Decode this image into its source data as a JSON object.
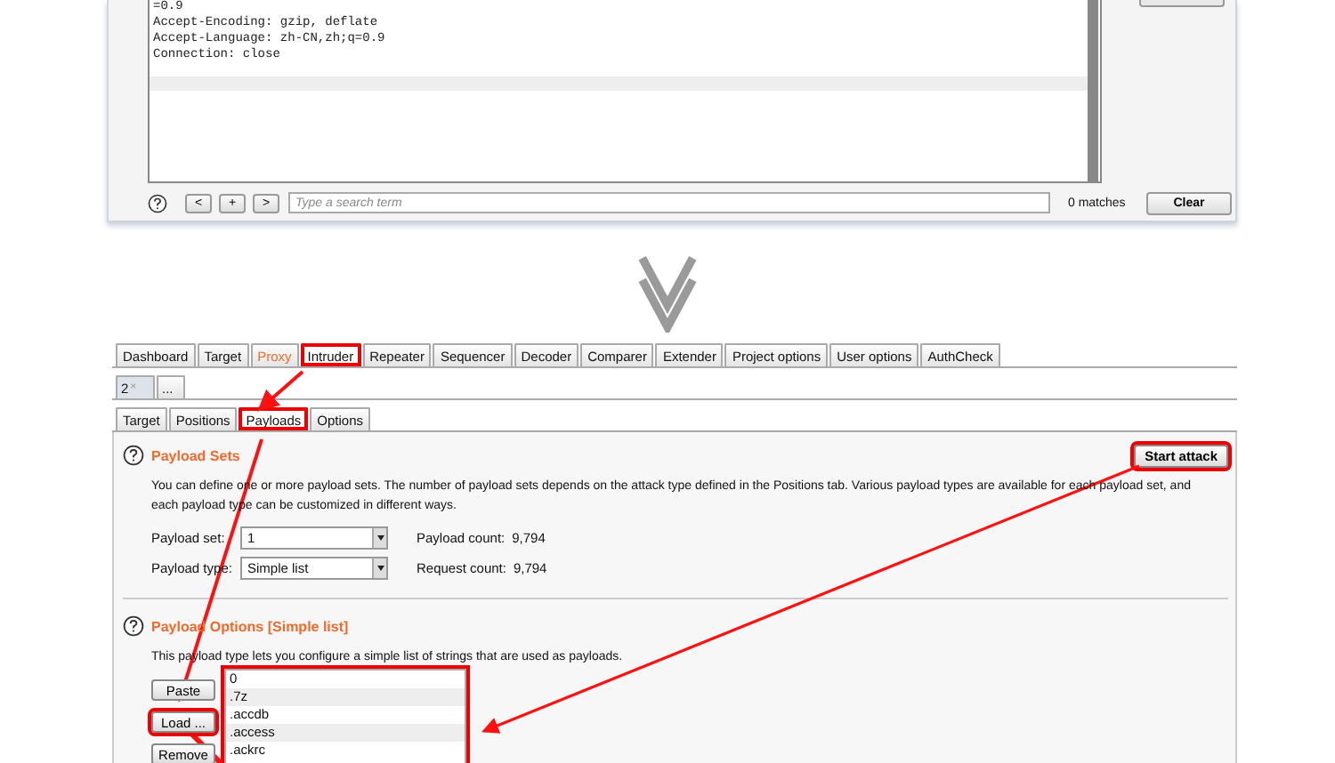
{
  "request_editor": {
    "lines": [
      "=0.9",
      "Accept-Encoding: gzip, deflate",
      "Accept-Language: zh-CN,zh;q=0.9",
      "Connection: close"
    ],
    "search": {
      "buttons": [
        "<",
        "+",
        ">"
      ],
      "placeholder": "Type a search term",
      "matches": "0 matches",
      "clear_button": "Clear"
    }
  },
  "main_tabs": [
    {
      "label": "Dashboard",
      "selected": false,
      "alert": false,
      "highlighted": false
    },
    {
      "label": "Target",
      "selected": false,
      "alert": false,
      "highlighted": false
    },
    {
      "label": "Proxy",
      "selected": false,
      "alert": true,
      "highlighted": false
    },
    {
      "label": "Intruder",
      "selected": true,
      "alert": false,
      "highlighted": true
    },
    {
      "label": "Repeater",
      "selected": false,
      "alert": false,
      "highlighted": false
    },
    {
      "label": "Sequencer",
      "selected": false,
      "alert": false,
      "highlighted": false
    },
    {
      "label": "Decoder",
      "selected": false,
      "alert": false,
      "highlighted": false
    },
    {
      "label": "Comparer",
      "selected": false,
      "alert": false,
      "highlighted": false
    },
    {
      "label": "Extender",
      "selected": false,
      "alert": false,
      "highlighted": false
    },
    {
      "label": "Project options",
      "selected": false,
      "alert": false,
      "highlighted": false
    },
    {
      "label": "User options",
      "selected": false,
      "alert": false,
      "highlighted": false
    },
    {
      "label": "AuthCheck",
      "selected": false,
      "alert": false,
      "highlighted": false
    }
  ],
  "attack_tabs": [
    {
      "label": "2",
      "close": "×",
      "selected": true
    },
    {
      "label": "...",
      "selected": false
    }
  ],
  "sub_tabs": [
    {
      "label": "Target",
      "selected": false,
      "highlighted": false
    },
    {
      "label": "Positions",
      "selected": false,
      "highlighted": false
    },
    {
      "label": "Payloads",
      "selected": true,
      "highlighted": true
    },
    {
      "label": "Options",
      "selected": false,
      "highlighted": false
    }
  ],
  "payload_sets": {
    "title": "Payload Sets",
    "start_attack": {
      "label": "Start attack",
      "highlighted": true
    },
    "description": "You can define one or more payload sets. The number of payload sets depends on the attack type defined in the Positions tab. Various payload types are available for each payload set, and each payload type can be customized in different ways.",
    "fields": [
      {
        "label": "Payload set:",
        "value": "1",
        "info_label": "Payload count:",
        "info_value": "9,794"
      },
      {
        "label": "Payload type:",
        "value": "Simple list",
        "info_label": "Request count:",
        "info_value": "9,794"
      }
    ]
  },
  "payload_options": {
    "title": "Payload Options [Simple list]",
    "description": "This payload type lets you configure a simple list of strings that are used as payloads.",
    "buttons": [
      {
        "label": "Paste",
        "highlighted": false
      },
      {
        "label": "Load ...",
        "highlighted": true
      },
      {
        "label": "Remove",
        "highlighted": false
      }
    ],
    "list_highlighted": true,
    "items": [
      "0",
      ".7z",
      ".accdb",
      ".access",
      ".ackrc"
    ]
  }
}
